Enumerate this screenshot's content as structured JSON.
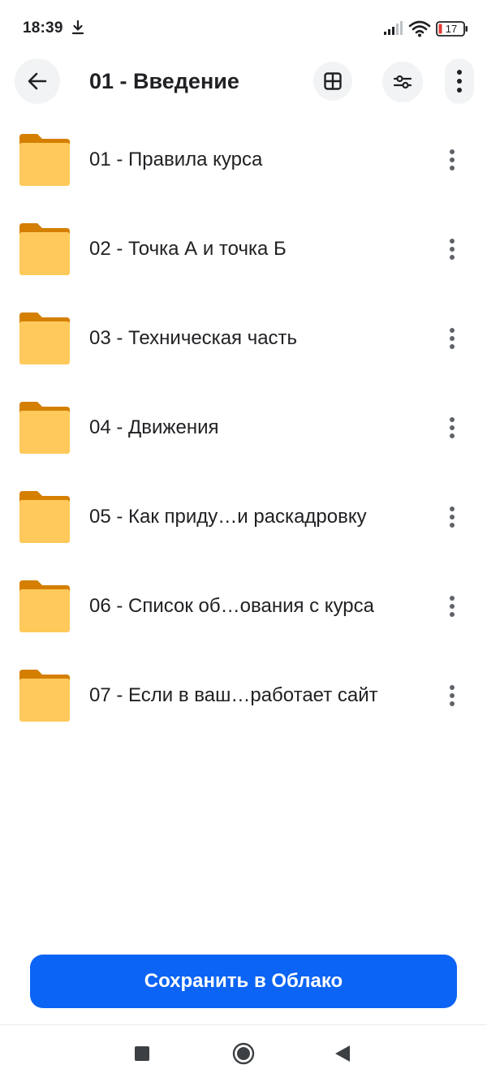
{
  "status_bar": {
    "time": "18:39",
    "battery": "17",
    "icons": [
      "download-icon",
      "signal-icon",
      "wifi-icon",
      "battery-icon"
    ]
  },
  "app_bar": {
    "title": "01 - Введение",
    "icons": [
      "arrow-back-icon",
      "grid-view-icon",
      "filter-icon",
      "more-vert-icon"
    ]
  },
  "folders": [
    {
      "name": "01 - Правила курса"
    },
    {
      "name": "02 - Точка А и точка Б"
    },
    {
      "name": "03 - Техническая часть"
    },
    {
      "name": "04 - Движения"
    },
    {
      "name": "05 - Как приду…и раскадровку"
    },
    {
      "name": "06 - Список об…ования с курса"
    },
    {
      "name": "07 - Если в ваш…работает сайт"
    }
  ],
  "save_button": {
    "label": "Сохранить в Облако"
  },
  "colors": {
    "accent": "#0b64f4",
    "folder_body": "#ffc95b",
    "folder_tab": "#d47f00",
    "icon_button_bg": "#f1f3f4",
    "text": "#202124"
  }
}
